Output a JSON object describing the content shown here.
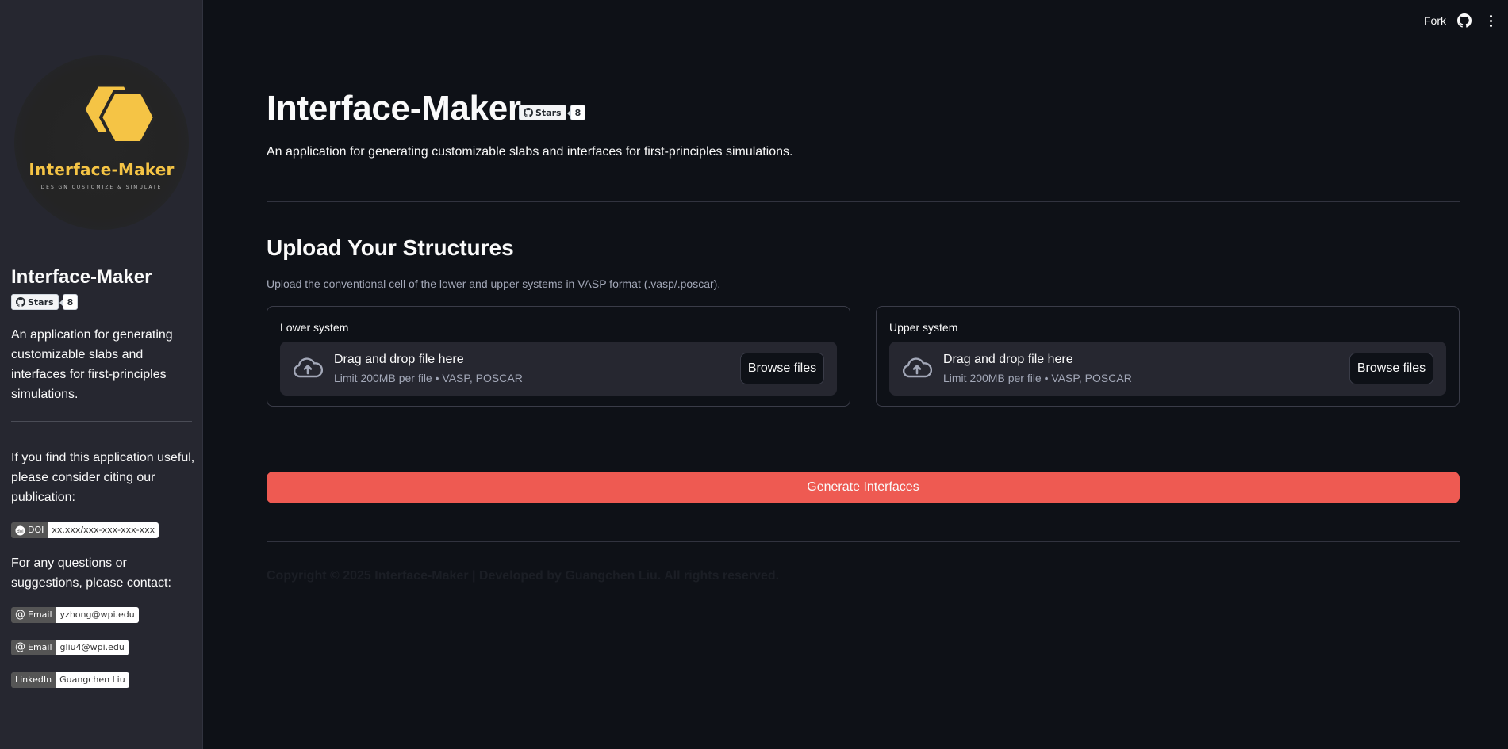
{
  "colors": {
    "background": "#0e1117",
    "sidebar": "#262730",
    "primary_button": "#ee5a52",
    "logo_yellow": "#f5c445"
  },
  "topbar": {
    "fork_label": "Fork",
    "github_icon": "github-icon",
    "menu_icon": "more-vert-icon"
  },
  "sidebar": {
    "logo": {
      "title": "Interface-Maker",
      "tagline": "DESIGN CUSTOMIZE & SIMULATE"
    },
    "title": "Interface-Maker",
    "stars_badge": {
      "label": "Stars",
      "count": "8"
    },
    "description": "An application for generating customizable slabs and interfaces for first-principles simulations.",
    "cite_text": "If you find this application useful, please consider citing our publication:",
    "doi_badge": {
      "label": "DOI",
      "value": "xx.xxx/xxx-xxx-xxx-xxx"
    },
    "contact_text": "For any questions or suggestions, please contact:",
    "email_badges": [
      {
        "label": "Email",
        "value": "yzhong@wpi.edu"
      },
      {
        "label": "Email",
        "value": "gliu4@wpi.edu"
      }
    ],
    "linkedin_badge": {
      "label": "LinkedIn",
      "value": "Guangchen Liu"
    }
  },
  "main": {
    "title": "Interface-Maker",
    "stars_badge": {
      "label": "Stars",
      "count": "8"
    },
    "subtitle": "An application for generating customizable slabs and interfaces for first-principles simulations.",
    "upload_section": {
      "title": "Upload Your Structures",
      "caption": "Upload the conventional cell of the lower and upper systems in VASP format (.vasp/.poscar).",
      "uploaders": [
        {
          "label": "Lower system",
          "drag_text": "Drag and drop file here",
          "limit_text": "Limit 200MB per file • VASP, POSCAR",
          "button": "Browse files"
        },
        {
          "label": "Upper system",
          "drag_text": "Drag and drop file here",
          "limit_text": "Limit 200MB per file • VASP, POSCAR",
          "button": "Browse files"
        }
      ]
    },
    "generate_button": "Generate Interfaces",
    "footer": "Copyright © 2025 Interface-Maker | Developed by Guangchen Liu. All rights reserved."
  }
}
